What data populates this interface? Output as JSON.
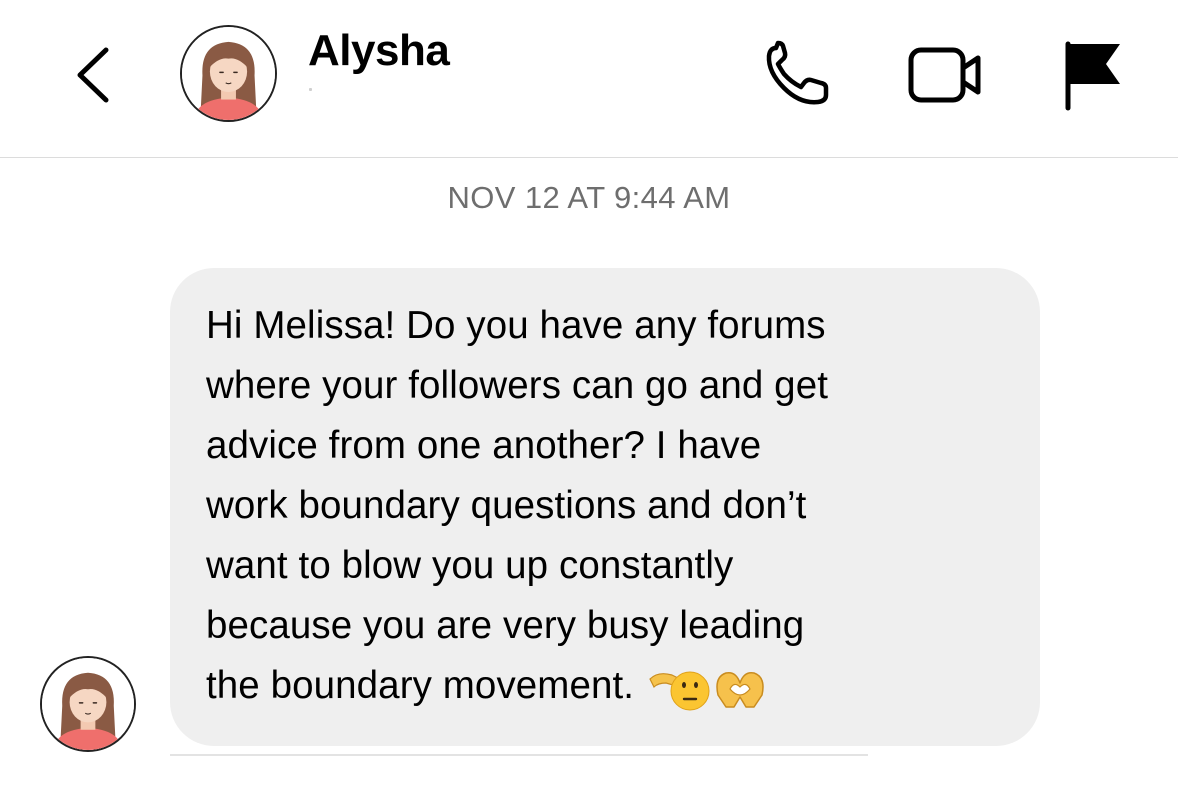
{
  "header": {
    "contact_name": "Alysha"
  },
  "conversation": {
    "timestamp": "NOV 12 AT 9:44 AM",
    "messages": [
      {
        "sender": "Alysha",
        "text": "Hi Melissa! Do you have any forums\nwhere your followers can go and get\nadvice from one another? I have\nwork boundary questions and don’t\nwant to blow you up constantly\nbecause you are very busy leading\nthe boundary movement.",
        "emojis": [
          "saluting-face",
          "heart-hands"
        ]
      }
    ]
  },
  "icons": {
    "back": "chevron-left-icon",
    "call": "phone-icon",
    "video": "video-camera-icon",
    "report": "flag-icon"
  },
  "colors": {
    "bubble_bg": "#efefef",
    "timestamp": "#6e6e6e",
    "divider": "#dcdcdc",
    "avatar_hair": "#8a5a44",
    "avatar_skin": "#f6d7c3",
    "avatar_shirt": "#ef6f6c"
  }
}
